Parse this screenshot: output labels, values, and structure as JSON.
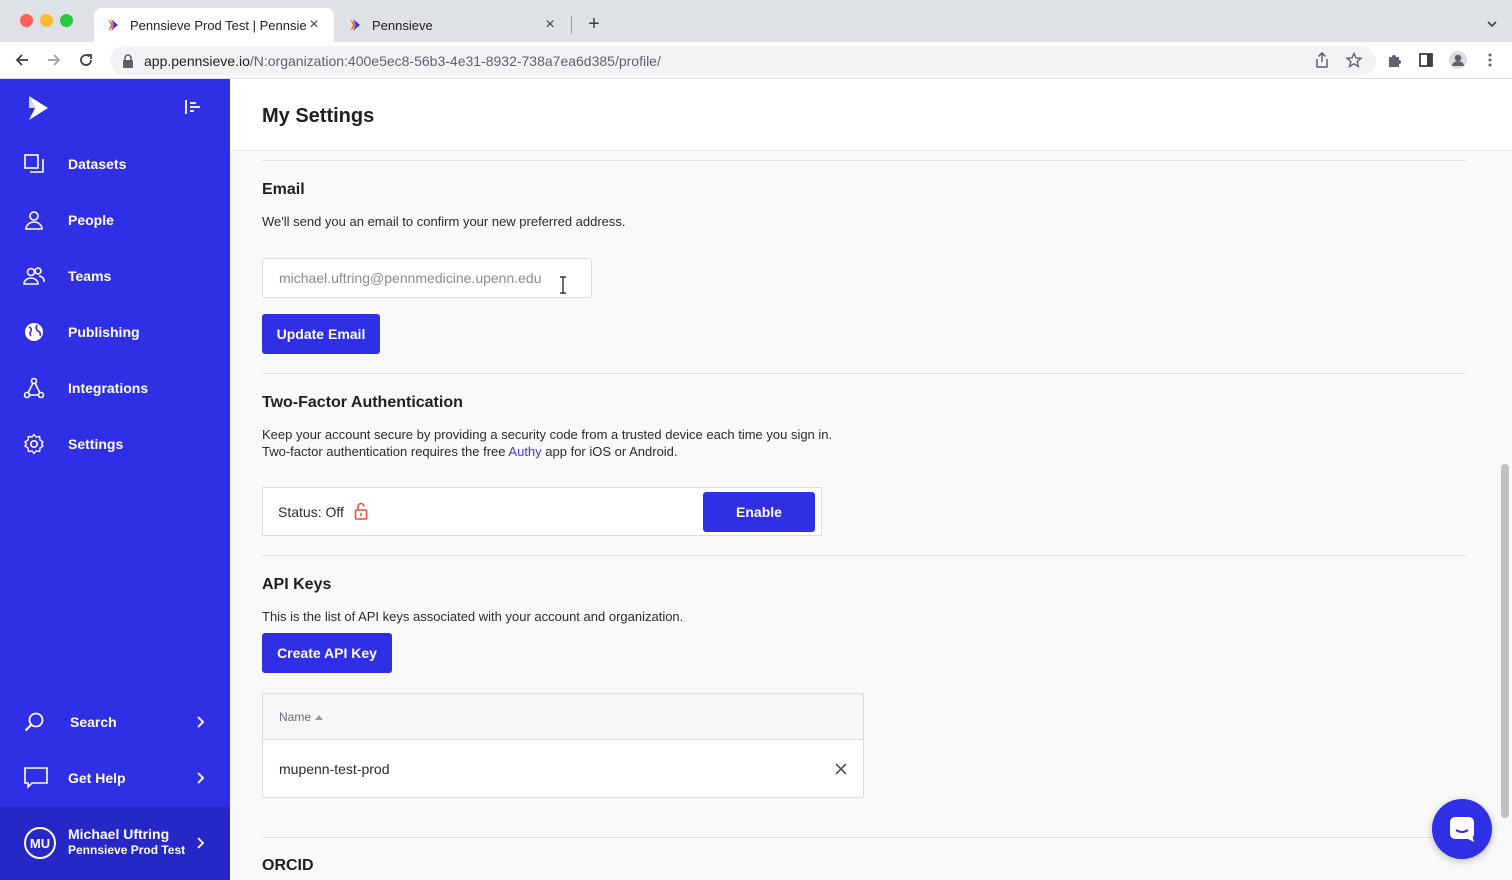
{
  "browser": {
    "tabs": [
      {
        "title": "Pennsieve Prod Test | Pennsieve",
        "active": true
      },
      {
        "title": "Pennsieve",
        "active": false
      }
    ],
    "url_host": "app.pennsieve.io",
    "url_path": "/N:organization:400e5ec8-56b3-4e31-8932-738a7ea6d385/profile/"
  },
  "sidebar": {
    "nav": [
      {
        "label": "Datasets",
        "icon": "datasets-icon"
      },
      {
        "label": "People",
        "icon": "person-icon"
      },
      {
        "label": "Teams",
        "icon": "teams-icon"
      },
      {
        "label": "Publishing",
        "icon": "globe-icon"
      },
      {
        "label": "Integrations",
        "icon": "integrations-icon"
      },
      {
        "label": "Settings",
        "icon": "gear-icon"
      }
    ],
    "bottom": [
      {
        "label": "Search",
        "icon": "search-icon"
      },
      {
        "label": "Get Help",
        "icon": "chat-icon"
      }
    ],
    "user": {
      "initials": "MU",
      "name": "Michael Uftring",
      "org": "Pennsieve Prod Test"
    },
    "accent": "#2f2fe5"
  },
  "page": {
    "title": "My Settings",
    "email": {
      "title": "Email",
      "description": "We'll send you an email to confirm your new preferred address.",
      "value": "michael.uftring@pennmedicine.upenn.edu",
      "button": "Update Email"
    },
    "two_factor": {
      "title": "Two-Factor Authentication",
      "line1": "Keep your account secure by providing a security code from a trusted device each time you sign in.",
      "line2_before": "Two-factor authentication requires the free ",
      "line2_link": "Authy",
      "line2_after": " app for iOS or Android.",
      "status": "Status: Off",
      "button": "Enable"
    },
    "api_keys": {
      "title": "API Keys",
      "description": "This is the list of API keys associated with your account and organization.",
      "button": "Create API Key",
      "column": "Name",
      "rows": [
        {
          "name": "mupenn-test-prod"
        }
      ]
    },
    "orcid": {
      "title": "ORCID"
    }
  }
}
